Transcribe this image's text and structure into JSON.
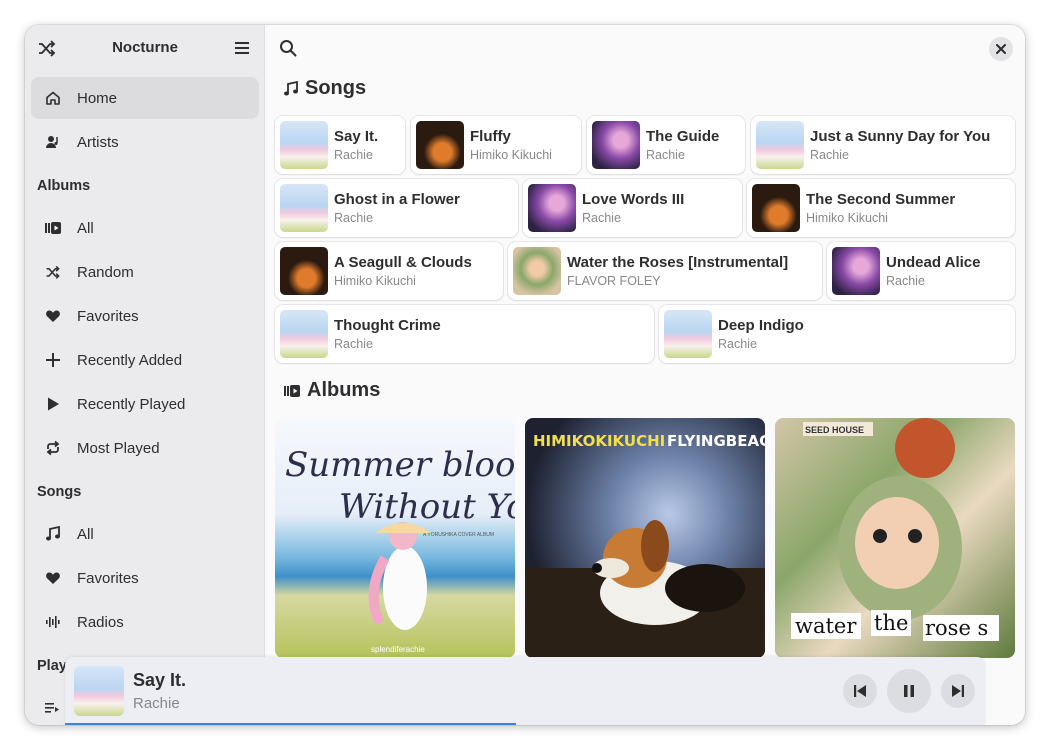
{
  "app": {
    "title": "Nocturne"
  },
  "sidebar": {
    "top_items": [
      {
        "label": "Home",
        "icon": "home-icon",
        "active": true
      },
      {
        "label": "Artists",
        "icon": "artist-icon",
        "active": false
      }
    ],
    "albums_heading": "Albums",
    "album_items": [
      {
        "label": "All",
        "icon": "album-icon"
      },
      {
        "label": "Random",
        "icon": "shuffle-icon"
      },
      {
        "label": "Favorites",
        "icon": "heart-icon"
      },
      {
        "label": "Recently Added",
        "icon": "plus-icon"
      },
      {
        "label": "Recently Played",
        "icon": "play-icon"
      },
      {
        "label": "Most Played",
        "icon": "repeat-icon"
      }
    ],
    "songs_heading": "Songs",
    "song_items": [
      {
        "label": "All",
        "icon": "music-note-icon"
      },
      {
        "label": "Favorites",
        "icon": "heart-icon"
      },
      {
        "label": "Radios",
        "icon": "radio-wave-icon"
      }
    ],
    "playlists_heading": "Playl"
  },
  "main": {
    "songs_heading": "Songs",
    "albums_heading": "Albums",
    "songs": [
      {
        "title": "Say It.",
        "artist": "Rachie",
        "art": "summer"
      },
      {
        "title": "Fluffy",
        "artist": "Himiko Kikuchi",
        "art": "beagle"
      },
      {
        "title": "The Guide",
        "artist": "Rachie",
        "art": "purple"
      },
      {
        "title": "Just a Sunny Day for You",
        "artist": "Rachie",
        "art": "summer"
      },
      {
        "title": "Ghost in a Flower",
        "artist": "Rachie",
        "art": "summer"
      },
      {
        "title": "Love Words III",
        "artist": "Rachie",
        "art": "purple"
      },
      {
        "title": "The Second Summer",
        "artist": "Himiko Kikuchi",
        "art": "beagle"
      },
      {
        "title": "A Seagull & Clouds",
        "artist": "Himiko Kikuchi",
        "art": "beagle"
      },
      {
        "title": "Water the Roses [Instrumental]",
        "artist": "FLAVOR FOLEY",
        "art": "roses"
      },
      {
        "title": "Undead Alice",
        "artist": "Rachie",
        "art": "purple"
      },
      {
        "title": "Thought Crime",
        "artist": "Rachie",
        "art": "summer"
      },
      {
        "title": "Deep Indigo",
        "artist": "Rachie",
        "art": "summer"
      }
    ],
    "albums": [
      {
        "cover_text_1": "Summer blooms",
        "cover_text_2": "Without You",
        "cover_small": "A YORUSHIKA COVER ALBUM",
        "cover_credit": "splendiferachie"
      },
      {
        "cover_text_1": "HIMIKOKIKUCHI",
        "cover_text_2": "FLYINGBEAGLE"
      },
      {
        "cover_text_1": "water",
        "cover_text_2": "the",
        "cover_text_3": "rose s",
        "cover_small": "SEED HOUSE"
      }
    ]
  },
  "player": {
    "title": "Say It.",
    "artist": "Rachie",
    "progress": 0.49,
    "accent": "#3584e4"
  }
}
